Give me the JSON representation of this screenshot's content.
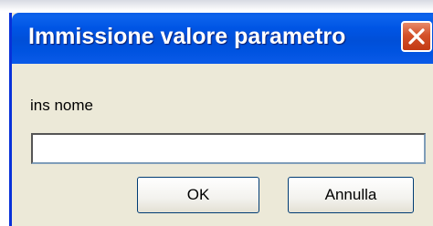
{
  "dialog": {
    "title": "Immissione valore parametro",
    "close_icon": "close-icon",
    "prompt_label": "ins nome",
    "input_value": "",
    "ok_label": "OK",
    "cancel_label": "Annulla"
  },
  "colors": {
    "titlebar": "#0055e5",
    "dialog_bg": "#ece9d8",
    "close_button": "#d4512a",
    "input_border": "#7f9db9"
  }
}
